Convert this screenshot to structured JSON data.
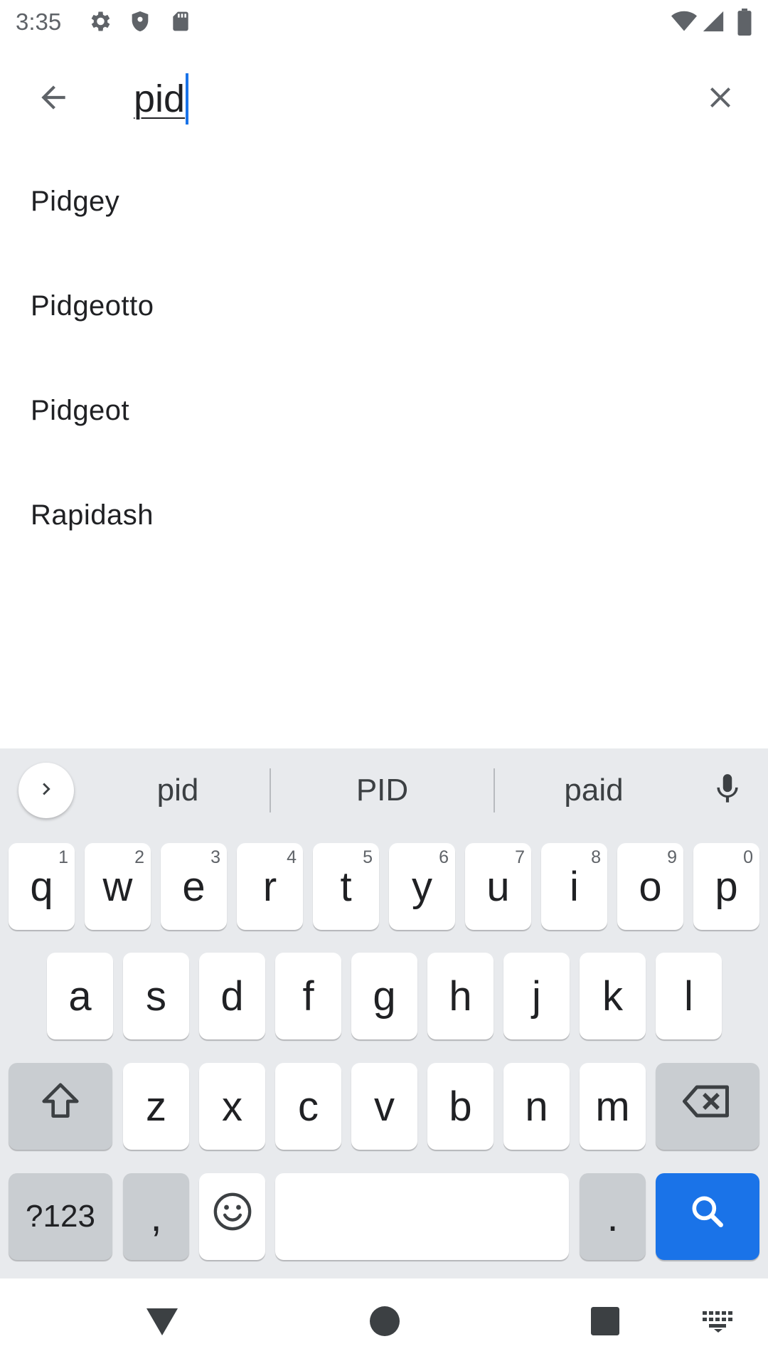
{
  "status_bar": {
    "time": "3:35",
    "left_icons": [
      "gear-icon",
      "shield-icon",
      "sd-card-icon"
    ],
    "right_icons": [
      "wifi-icon",
      "cell-signal-icon",
      "battery-icon"
    ]
  },
  "search": {
    "query": "pid",
    "back_icon": "arrow-back-icon",
    "clear_icon": "close-icon"
  },
  "results": [
    {
      "label": "Pidgey"
    },
    {
      "label": "Pidgeotto"
    },
    {
      "label": "Pidgeot"
    },
    {
      "label": "Rapidash"
    }
  ],
  "keyboard": {
    "suggestions": [
      "pid",
      "PID",
      "paid"
    ],
    "row1": [
      {
        "label": "q",
        "hint": "1"
      },
      {
        "label": "w",
        "hint": "2"
      },
      {
        "label": "e",
        "hint": "3"
      },
      {
        "label": "r",
        "hint": "4"
      },
      {
        "label": "t",
        "hint": "5"
      },
      {
        "label": "y",
        "hint": "6"
      },
      {
        "label": "u",
        "hint": "7"
      },
      {
        "label": "i",
        "hint": "8"
      },
      {
        "label": "o",
        "hint": "9"
      },
      {
        "label": "p",
        "hint": "0"
      }
    ],
    "row2": [
      "a",
      "s",
      "d",
      "f",
      "g",
      "h",
      "j",
      "k",
      "l"
    ],
    "row3": [
      "z",
      "x",
      "c",
      "v",
      "b",
      "n",
      "m"
    ],
    "symbols_label": "?123",
    "comma_label": ",",
    "period_label": ".",
    "accent_color": "#1a73e8"
  },
  "nav_bar": {
    "icons": [
      "back-triangle-icon",
      "home-circle-icon",
      "recents-square-icon",
      "keyboard-switch-icon"
    ]
  }
}
